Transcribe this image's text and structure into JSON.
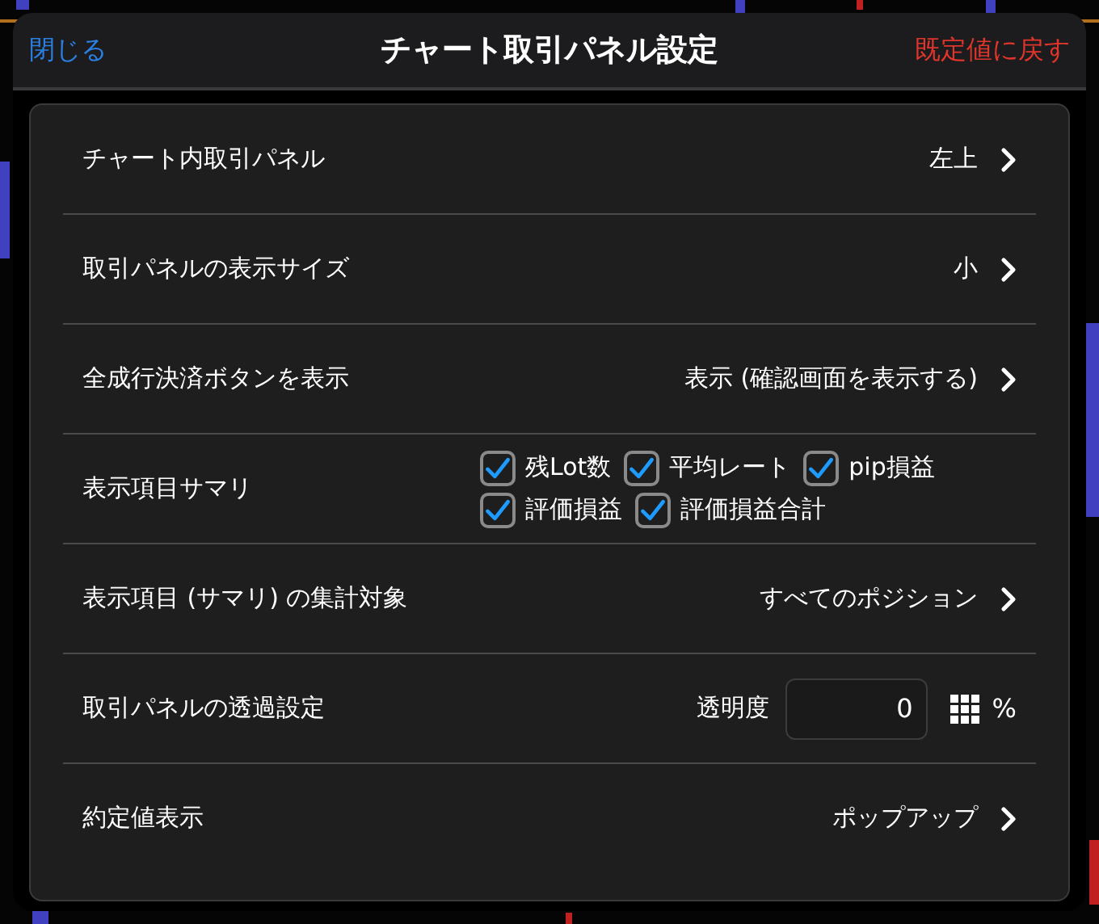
{
  "header": {
    "close": "閉じる",
    "title": "チャート取引パネル設定",
    "reset": "既定値に戻す"
  },
  "rows": [
    {
      "kind": "link",
      "label": "チャート内取引パネル",
      "value": "左上"
    },
    {
      "kind": "link",
      "label": "取引パネルの表示サイズ",
      "value": "小"
    },
    {
      "kind": "link",
      "label": "全成行決済ボタンを表示",
      "value": "表示 (確認画面を表示する)"
    },
    {
      "kind": "checks",
      "label": "表示項目サマリ",
      "options": [
        {
          "label": "残Lot数",
          "checked": true
        },
        {
          "label": "平均レート",
          "checked": true
        },
        {
          "label": "pip損益",
          "checked": true
        },
        {
          "label": "評価損益",
          "checked": true
        },
        {
          "label": "評価損益合計",
          "checked": true
        }
      ]
    },
    {
      "kind": "link",
      "label": "表示項目 (サマリ) の集計対象",
      "value": "すべてのポジション"
    },
    {
      "kind": "input",
      "label": "取引パネルの透過設定",
      "field_label": "透明度",
      "value": "0",
      "unit": "%"
    },
    {
      "kind": "link",
      "label": "約定値表示",
      "value": "ポップアップ"
    }
  ]
}
